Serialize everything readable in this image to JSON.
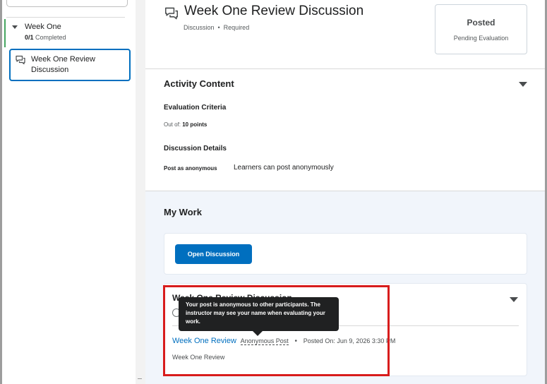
{
  "sidebar": {
    "module": {
      "title": "Week One",
      "progress_done": "0/1",
      "progress_label": " Completed"
    },
    "topic": {
      "label": "Week One Review Discussion",
      "icon": "discussion-icon"
    }
  },
  "header": {
    "title": "Week One Review Discussion",
    "type": "Discussion",
    "requirement": "Required",
    "status": "Posted",
    "status_detail": "Pending Evaluation"
  },
  "activity": {
    "heading": "Activity Content",
    "criteria_heading": "Evaluation Criteria",
    "out_of_label": "Out of: ",
    "out_of_value": "10 points",
    "details_heading": "Discussion Details",
    "anon_key": "Post as anonymous",
    "anon_value": "Learners can post anonymously"
  },
  "mywork": {
    "heading": "My Work",
    "open_button": "Open Discussion",
    "post": {
      "title": "Week One Review Discussion",
      "link": "Week One Review",
      "anon_label": "Anonymous Post",
      "posted_on": "Posted On: Jun 9, 2026 3:30 PM",
      "body": "Week One Review",
      "tooltip": "Your post is anonymous to other participants. The instructor may see your name when evaluating your work."
    }
  },
  "colors": {
    "accent": "#006fbf",
    "highlight": "#d81c1c",
    "progress": "#46a661"
  }
}
